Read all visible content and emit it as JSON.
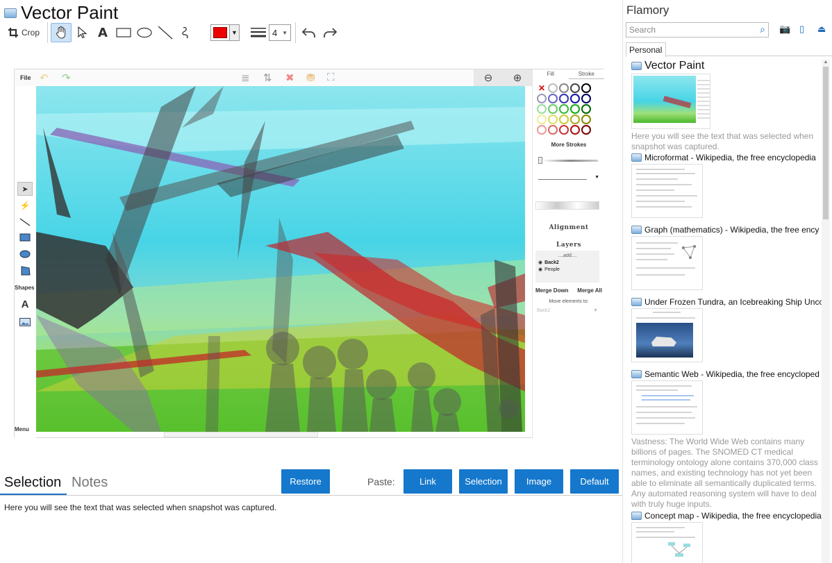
{
  "app": {
    "title": "Vector Paint"
  },
  "toolbar": {
    "crop_label": "Crop",
    "line_width": "4"
  },
  "editor": {
    "file_menu": "File",
    "menu_label": "Menu",
    "shapes_label": "Shapes",
    "panel_tabs": [
      "Fill",
      "Stroke"
    ],
    "more_strokes": "More Strokes",
    "alignment": "Alignment",
    "layers": "Layers",
    "layers_list": {
      "add": "....add....",
      "items": [
        "Back2",
        "People"
      ]
    },
    "merge_down": "Merge Down",
    "merge_all": "Merge All",
    "move_elements": "Move elements to:",
    "move_target": "Back2"
  },
  "bottom": {
    "tabs": {
      "selection": "Selection",
      "notes": "Notes"
    },
    "restore": "Restore",
    "paste_label": "Paste:",
    "paste_buttons": {
      "link": "Link",
      "selection": "Selection",
      "image": "Image",
      "default": "Default"
    },
    "selection_text": "Here you will see the text that was selected when snapshot was captured."
  },
  "flamory": {
    "title": "Flamory",
    "search_placeholder": "Search",
    "tab": "Personal",
    "items": [
      {
        "title": "Vector Paint",
        "desc": "Here you will see the text that was selected when snapshot was captured."
      },
      {
        "title": "Microformat - Wikipedia, the free encyclopedia"
      },
      {
        "title": "Graph (mathematics) - Wikipedia, the free ency"
      },
      {
        "title": "Under Frozen Tundra, an Icebreaking Ship Unco"
      },
      {
        "title": "Semantic Web - Wikipedia, the free encycloped",
        "desc": "Vastness: The World Wide Web contains many billions of pages. The SNOMED CT medical terminology ontology alone contains 370,000 class names, and existing technology has not yet been able to eliminate all semantically duplicated terms. Any automated reasoning system will have to deal with truly huge inputs."
      },
      {
        "title": "Concept map - Wikipedia, the free encyclopedia"
      }
    ]
  },
  "colors": {
    "accent": "#1578cc",
    "stroke_color": "#ee0000"
  }
}
